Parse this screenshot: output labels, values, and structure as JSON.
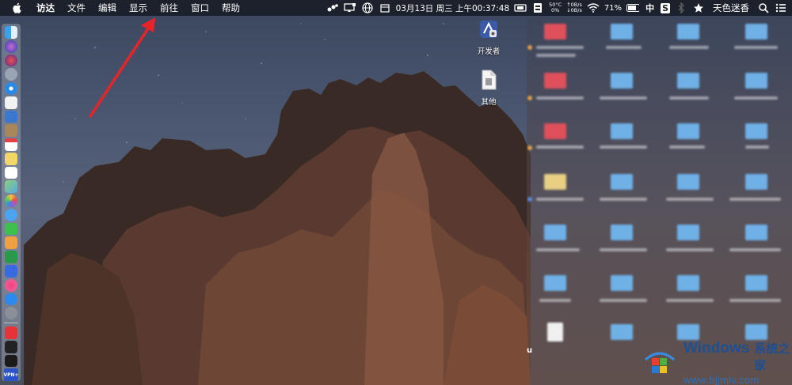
{
  "menubar": {
    "items": [
      "访达",
      "文件",
      "编辑",
      "显示",
      "前往",
      "窗口",
      "帮助"
    ],
    "clock": "03月13日 周三 上午00:37:48",
    "temp": {
      "top": "50°C",
      "bottom": "0%"
    },
    "network": {
      "up": "0B/s",
      "down": "0B/s"
    },
    "battery": "71%",
    "ime_cn": "中",
    "ime_s": "S",
    "user": "天色迷香"
  },
  "desktop": {
    "icons": [
      {
        "label": "开发者",
        "icon": "developer-app-icon"
      },
      {
        "label": "其他",
        "icon": "document-icon"
      }
    ],
    "partial_label": "u"
  },
  "dock": {
    "apps": [
      "finder-icon",
      "siri-icon",
      "launchpad-icon",
      "safari-icon",
      "preview-icon",
      "notes-icon",
      "calendar-icon",
      "reminders-icon",
      "notes-list-icon",
      "maps-icon",
      "photos-icon",
      "messages-icon",
      "facetime-icon",
      "pages-icon",
      "numbers-icon",
      "keynote-icon",
      "itunes-icon",
      "app-store-icon",
      "system-preferences-icon",
      "vivaldi-icon",
      "terminal-icon",
      "stocks-icon",
      "vpn-icon"
    ],
    "vpn_label": "VPN+"
  },
  "colors": {
    "menubar": "#181c26",
    "arrow": "#e8232a",
    "watermark_blue": "#1f4f8f"
  },
  "watermark": {
    "brand": "Windows",
    "cn": "系统之家",
    "url": "www.bjjmlv.com"
  }
}
